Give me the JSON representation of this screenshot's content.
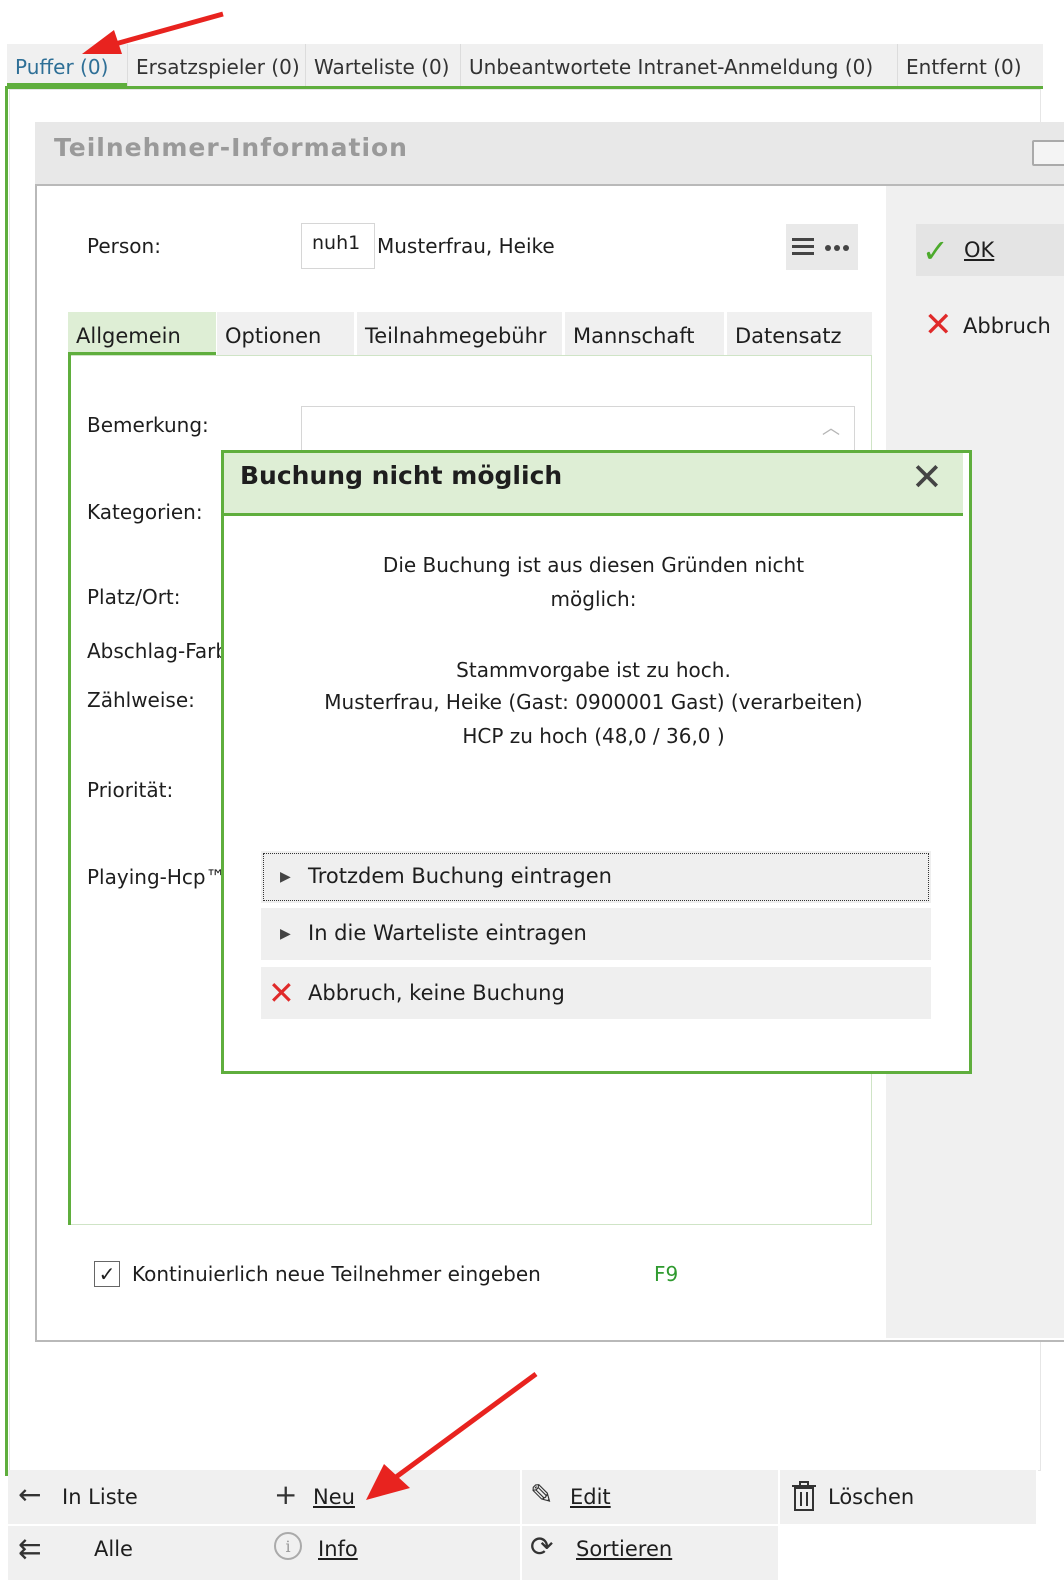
{
  "top_tabs": [
    {
      "label": "Puffer (0)"
    },
    {
      "label": "Ersatzspieler (0)"
    },
    {
      "label": "Warteliste (0)"
    },
    {
      "label": "Unbeantwortete Intranet-Anmeldung (0)"
    },
    {
      "label": "Entfernt (0)"
    }
  ],
  "dialog": {
    "title": "Teilnehmer-Information",
    "person_label": "Person:",
    "person_code": "nuh1",
    "person_name": "Musterfrau, Heike",
    "ok": "OK",
    "cancel": "Abbruch",
    "tabs": [
      "Allgemein",
      "Optionen",
      "Teilnahmegebühr",
      "Mannschaft",
      "Datensatz"
    ],
    "fields": {
      "bemerkung": "Bemerkung:",
      "kategorien": "Kategorien:",
      "platz": "Platz/Ort:",
      "abschlag": "Abschlag-Farb",
      "zaehlweise": "Zählweise:",
      "prioritaet": "Priorität:",
      "playing_hcp": "Playing-Hcp™"
    },
    "continuous_label": "Kontinuierlich neue Teilnehmer eingeben",
    "continuous_checked": true,
    "shortcut": "F9"
  },
  "popup": {
    "title": "Buchung nicht möglich",
    "message_line1": "Die Buchung ist aus diesen Gründen nicht",
    "message_line2": "möglich:",
    "reason_line1": "Stammvorgabe ist zu hoch.",
    "reason_line2": "Musterfrau, Heike (Gast: 0900001 Gast) (verarbeiten)",
    "reason_line3": "HCP zu hoch (48,0  / 36,0 )",
    "choices": {
      "force": "Trotzdem Buchung eintragen",
      "waitlist": "In die Warteliste eintragen",
      "cancel": "Abbruch, keine Buchung"
    }
  },
  "bottom_bar": {
    "in_liste": "In Liste",
    "neu": "Neu",
    "edit": "Edit",
    "loeschen": "Löschen",
    "alle": "Alle",
    "info": "Info",
    "sortieren": "Sortieren"
  },
  "colors": {
    "accent_green": "#5fae3d",
    "header_green": "#deeed5",
    "ok_green": "#4caa2c",
    "cancel_red": "#e02a2a",
    "annotation_red": "#e8231f"
  }
}
